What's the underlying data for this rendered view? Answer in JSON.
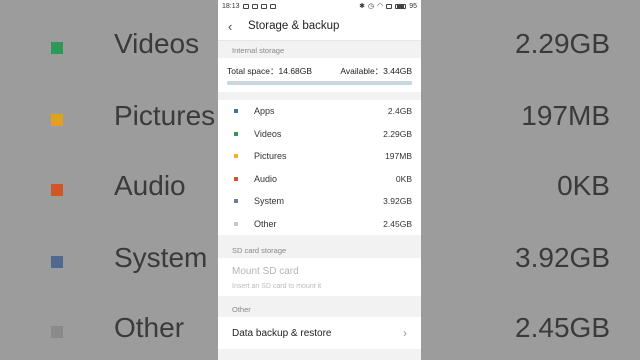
{
  "background": {
    "rows": [
      {
        "label": "Videos",
        "value": "2.29GB",
        "color": "#2e9a5a"
      },
      {
        "label": "Pictures",
        "value": "197MB",
        "color": "#e0a020"
      },
      {
        "label": "Audio",
        "value": "0KB",
        "color": "#d0562a"
      },
      {
        "label": "System",
        "value": "3.92GB",
        "color": "#4f6a8c"
      },
      {
        "label": "Other",
        "value": "2.45GB",
        "color": "#8a8a8a"
      }
    ]
  },
  "statusbar": {
    "time": "18:13",
    "battery": "95"
  },
  "header": {
    "back_icon": "back-arrow-icon",
    "title": "Storage & backup"
  },
  "internal": {
    "section_label": "Internal storage",
    "total_label": "Total space：14.68GB",
    "available_label": "Available：3.44GB"
  },
  "categories": [
    {
      "label": "Apps",
      "value": "2.4GB",
      "color": "#3f6fb0"
    },
    {
      "label": "Videos",
      "value": "2.29GB",
      "color": "#2e9a5a"
    },
    {
      "label": "Pictures",
      "value": "197MB",
      "color": "#f0b030"
    },
    {
      "label": "Audio",
      "value": "0KB",
      "color": "#d0562a"
    },
    {
      "label": "System",
      "value": "3.92GB",
      "color": "#6a7f95"
    },
    {
      "label": "Other",
      "value": "2.45GB",
      "color": "#c8c8c8"
    }
  ],
  "sd": {
    "section_label": "SD card storage",
    "title": "Mount SD card",
    "subtitle": "Insert an SD card to mount it"
  },
  "other": {
    "section_label": "Other",
    "backup_label": "Data backup & restore"
  }
}
